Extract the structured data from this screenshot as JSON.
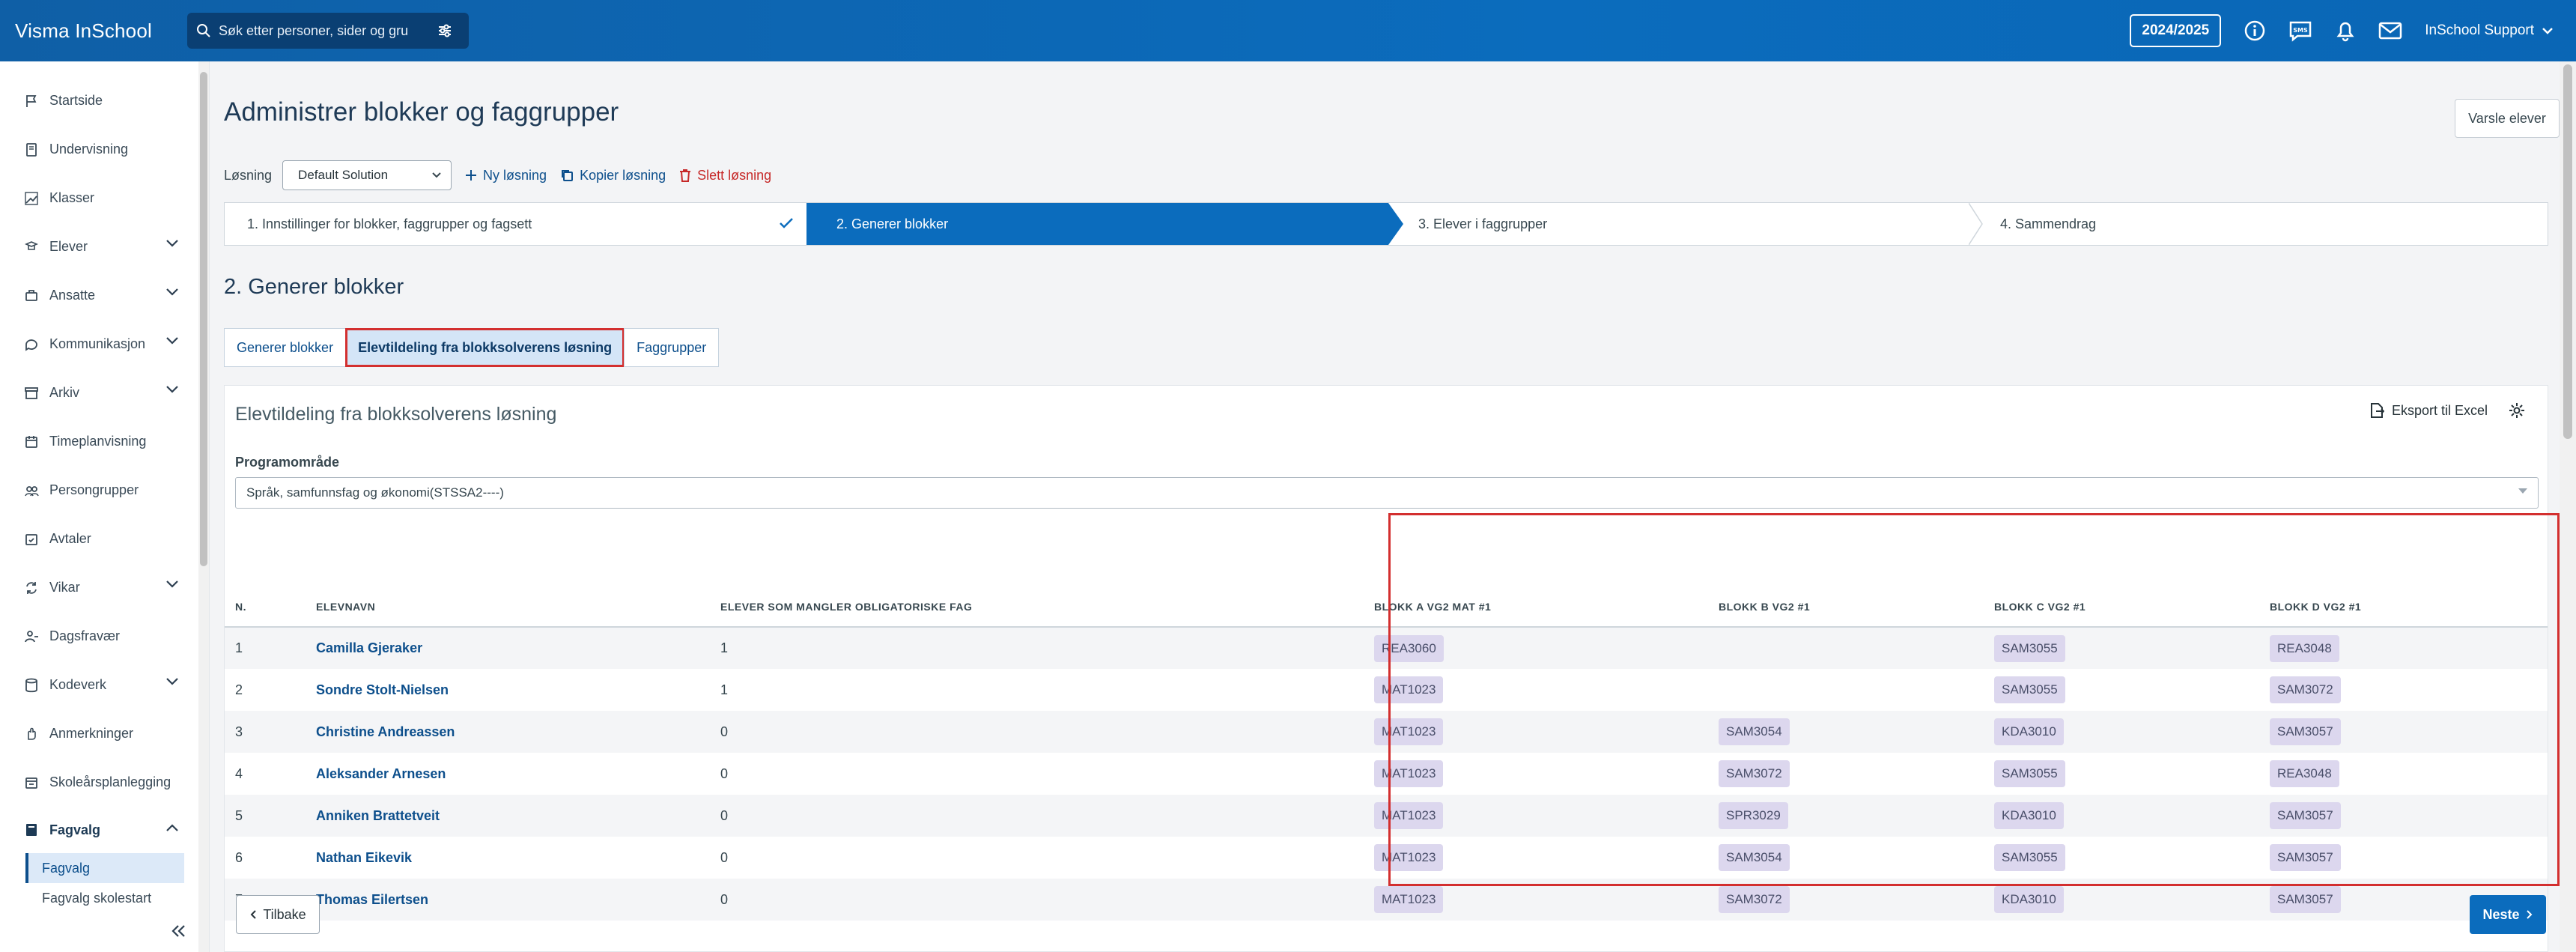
{
  "topbar": {
    "brand": "Visma InSchool",
    "search_placeholder": "Søk etter personer, sider og gru",
    "year": "2024/2025",
    "user": "InSchool Support"
  },
  "sidebar": {
    "items": [
      {
        "label": "Startside",
        "icon": "flag-icon"
      },
      {
        "label": "Undervisning",
        "icon": "book-icon"
      },
      {
        "label": "Klasser",
        "icon": "classes-icon"
      },
      {
        "label": "Elever",
        "icon": "student-icon",
        "expandable": true
      },
      {
        "label": "Ansatte",
        "icon": "staff-icon",
        "expandable": true
      },
      {
        "label": "Kommunikasjon",
        "icon": "chat-icon",
        "expandable": true
      },
      {
        "label": "Arkiv",
        "icon": "archive-icon",
        "expandable": true
      },
      {
        "label": "Timeplanvisning",
        "icon": "calendar-icon"
      },
      {
        "label": "Persongrupper",
        "icon": "group-icon"
      },
      {
        "label": "Avtaler",
        "icon": "calendar-check-icon"
      },
      {
        "label": "Vikar",
        "icon": "swap-icon",
        "expandable": true
      },
      {
        "label": "Dagsfravær",
        "icon": "person-absence-icon"
      },
      {
        "label": "Kodeverk",
        "icon": "database-icon",
        "expandable": true
      },
      {
        "label": "Anmerkninger",
        "icon": "hand-icon"
      },
      {
        "label": "Skoleårsplanlegging",
        "icon": "calendar-plan-icon"
      }
    ],
    "open_section": {
      "label": "Fagvalg",
      "icon": "book-open-icon"
    },
    "subitems": [
      "Fagvalg",
      "Fagvalg skolestart"
    ]
  },
  "page": {
    "title": "Administrer blokker og faggrupper",
    "varsle_button": "Varsle elever",
    "losning_label": "Løsning",
    "losning_value": "Default Solution",
    "ny_losning": "Ny løsning",
    "kopier_losning": "Kopier løsning",
    "slett_losning": "Slett løsning"
  },
  "stepper": {
    "steps": [
      "1. Innstillinger for blokker, faggrupper og fagsett",
      "2. Generer blokker",
      "3. Elever i faggrupper",
      "4. Sammendrag"
    ],
    "active_step": 2
  },
  "section": {
    "title": "2. Generer blokker",
    "tabs": [
      "Generer blokker",
      "Elevtildeling fra blokksolverens løsning",
      "Faggrupper"
    ],
    "active_tab": 1
  },
  "card": {
    "title": "Elevtildeling fra blokksolverens løsning",
    "export_label": "Eksport til Excel",
    "program_label": "Programområde",
    "program_value": "Språk, samfunnsfag og økonomi(STSSA2----)"
  },
  "table": {
    "headers": [
      "N.",
      "ELEVNAVN",
      "ELEVER SOM MANGLER OBLIGATORISKE FAG",
      "BLOKK A VG2 MAT #1",
      "BLOKK B VG2 #1",
      "BLOKK C VG2 #1",
      "BLOKK D VG2 #1"
    ],
    "rows": [
      {
        "n": "1",
        "name": "Camilla Gjeraker",
        "missing": "1",
        "a": "REA3060",
        "b": "",
        "c": "SAM3055",
        "d": "REA3048"
      },
      {
        "n": "2",
        "name": "Sondre Stolt-Nielsen",
        "missing": "1",
        "a": "MAT1023",
        "b": "",
        "c": "SAM3055",
        "d": "SAM3072"
      },
      {
        "n": "3",
        "name": "Christine Andreassen",
        "missing": "0",
        "a": "MAT1023",
        "b": "SAM3054",
        "c": "KDA3010",
        "d": "SAM3057"
      },
      {
        "n": "4",
        "name": "Aleksander Arnesen",
        "missing": "0",
        "a": "MAT1023",
        "b": "SAM3072",
        "c": "SAM3055",
        "d": "REA3048"
      },
      {
        "n": "5",
        "name": "Anniken Brattetveit",
        "missing": "0",
        "a": "MAT1023",
        "b": "SPR3029",
        "c": "KDA3010",
        "d": "SAM3057"
      },
      {
        "n": "6",
        "name": "Nathan Eikevik",
        "missing": "0",
        "a": "MAT1023",
        "b": "SAM3054",
        "c": "SAM3055",
        "d": "SAM3057"
      },
      {
        "n": "7",
        "name": "Thomas Eilertsen",
        "missing": "0",
        "a": "MAT1023",
        "b": "SAM3072",
        "c": "KDA3010",
        "d": "SAM3057"
      }
    ]
  },
  "footer": {
    "back": "Tilbake",
    "next": "Neste"
  },
  "colors": {
    "brand_blue": "#0b6cbd",
    "highlight_red": "#d32f2f",
    "chip_bg": "#dcd7ee"
  }
}
